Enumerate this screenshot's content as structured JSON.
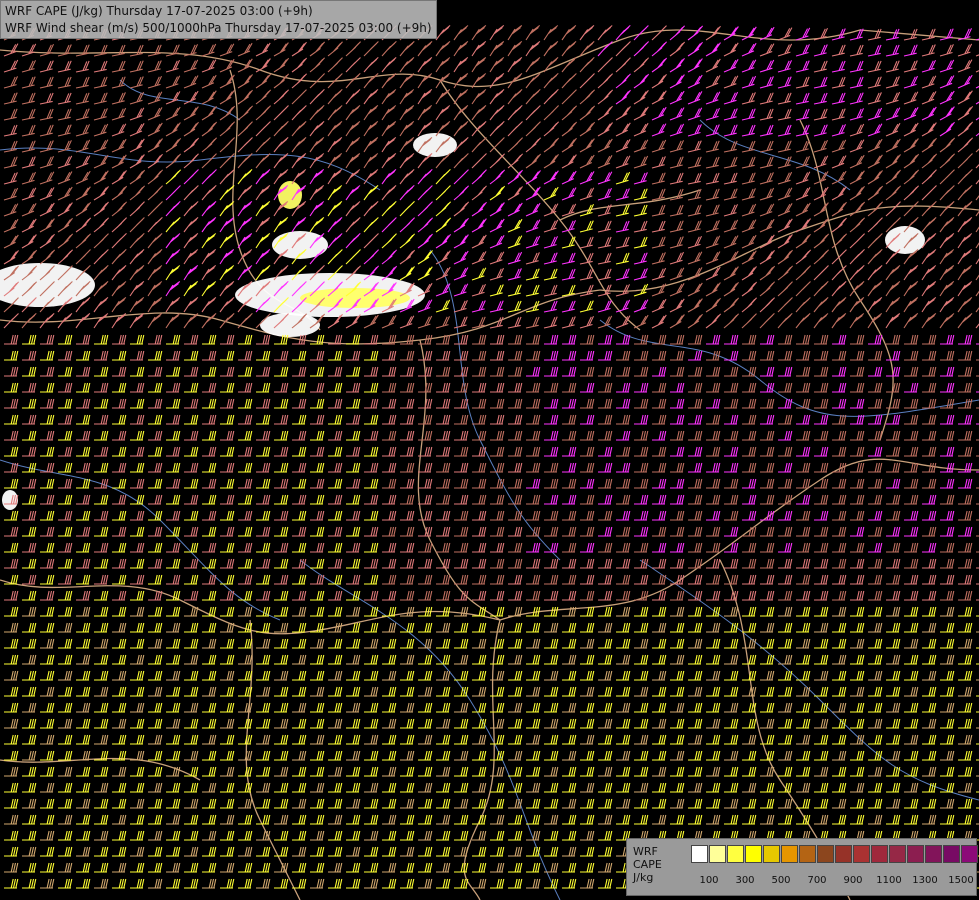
{
  "title": {
    "line1": "WRF CAPE (J/kg) Thursday 17-07-2025 03:00 (+9h)",
    "line2": "WRF Wind shear (m/s) 500/1000hPa Thursday 17-07-2025 03:00 (+9h)"
  },
  "legend": {
    "label_lines": [
      "WRF",
      "CAPE",
      "J/kg"
    ],
    "colors": [
      "#cfcfcf",
      "#ffffff",
      "#ffff99",
      "#ffff40",
      "#ffff00",
      "#e6c800",
      "#e69600",
      "#b46414",
      "#8c461e",
      "#963228",
      "#aa3232",
      "#a0283c",
      "#962846",
      "#8c1e50",
      "#82145a",
      "#780a64",
      "#8c0a78",
      "#aa1e8c"
    ],
    "tick_labels": [
      "100",
      "300",
      "500",
      "700",
      "900",
      "1100",
      "1300",
      "1500"
    ]
  },
  "colors": {
    "background": "#000000",
    "borders": "#c8a07a",
    "rivers": "#5a7fc0",
    "barb_low": "#c07060",
    "barb_mid": "#e07a7a",
    "barb_high": "#ff33ff",
    "barb_yellow": "#ffff33",
    "barb_tan": "#d2a86e",
    "cape_white": "#ffffff",
    "cape_yellow": "#ffff66"
  }
}
